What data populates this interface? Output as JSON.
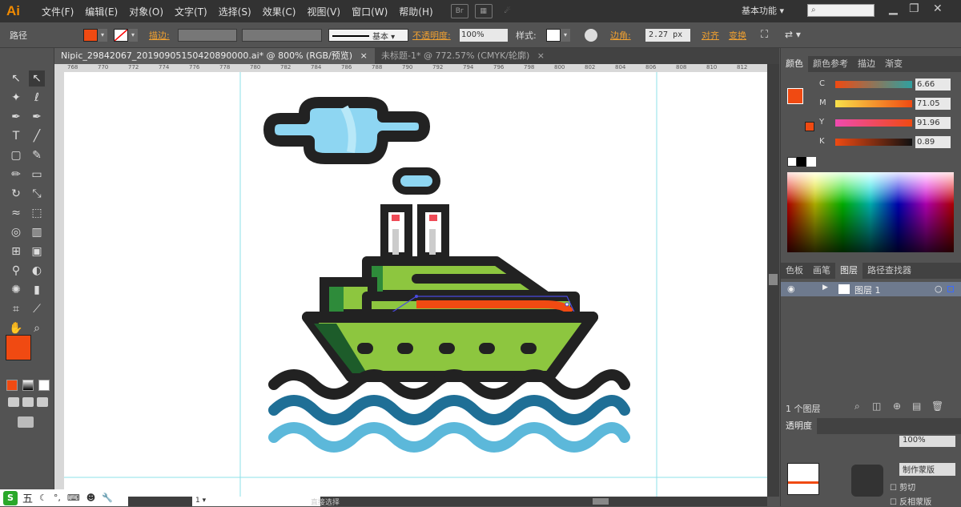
{
  "app": {
    "logo": "Ai",
    "menus": [
      "文件(F)",
      "编辑(E)",
      "对象(O)",
      "文字(T)",
      "选择(S)",
      "效果(C)",
      "视图(V)",
      "窗口(W)",
      "帮助(H)"
    ],
    "br_icon": "Br",
    "workspace": "基本功能",
    "search_placeholder": ""
  },
  "control": {
    "object_type": "路径",
    "stroke_label": "描边",
    "stroke_style": "基本",
    "opacity_label": "不透明度",
    "opacity_value": "100%",
    "style_label": "样式",
    "corner_label": "边角",
    "corner_value": "2.27 px",
    "align_label": "对齐",
    "transform_label": "变换",
    "fill_color": "#f04a12"
  },
  "tabs": [
    {
      "label": "Nipic_29842067_20190905150420890000.ai* @ 800% (RGB/预览)",
      "active": true
    },
    {
      "label": "未标题-1* @ 772.57% (CMYK/轮廓)",
      "active": false
    }
  ],
  "ruler": [
    "768",
    "770",
    "772",
    "774",
    "776",
    "778",
    "780",
    "782",
    "784",
    "786",
    "788",
    "790",
    "792",
    "794",
    "796",
    "798",
    "800",
    "802",
    "804",
    "806",
    "808",
    "810",
    "812"
  ],
  "color_panel": {
    "tabs": [
      "颜色",
      "颜色参考",
      "描边",
      "渐变"
    ],
    "c": "6.66",
    "m": "71.05",
    "y": "91.96",
    "k": "0.89",
    "c_label": "C",
    "m_label": "M",
    "y_label": "Y",
    "k_label": "K"
  },
  "layers_panel": {
    "tabs": [
      "色板",
      "画笔",
      "图层",
      "路径查找器"
    ],
    "layer_name": "图层 1",
    "layer_count": "1 个图层"
  },
  "transparency": {
    "title": "透明度",
    "opacity": "100%",
    "make_mask": "制作蒙版",
    "clip": "剪切",
    "invert": "反相蒙版"
  },
  "status": {
    "zoom": "1",
    "tool": "直接选择",
    "ime": "五"
  }
}
